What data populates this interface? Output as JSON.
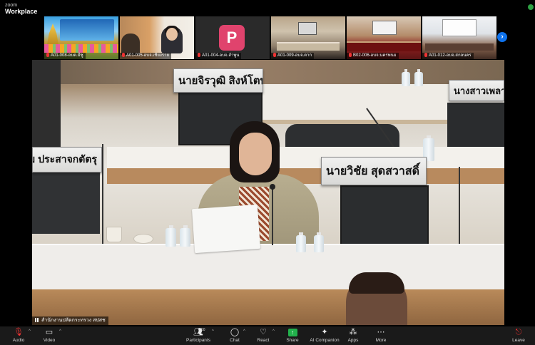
{
  "app": {
    "brand_small": "zoom",
    "brand_large": "Workplace"
  },
  "gallery_strip": {
    "tiles": [
      {
        "label": "A01-008-อบต.มีซู"
      },
      {
        "label": "A01-005-อบจ.เชียงราย"
      },
      {
        "label": "A01-004-อบจ.ลำพูน",
        "avatar_letter": "P",
        "avatar_color": "#e0436d"
      },
      {
        "label": "A01-009-อบจ.ตาก"
      },
      {
        "label": "B02-006-อบจ.นครพนม"
      },
      {
        "label": "A01-012-อบจ.สกลนคร"
      }
    ],
    "next_icon": "chevron-right-icon",
    "next_color": "#0e72ed"
  },
  "main_video": {
    "nameplates": {
      "back_left": "นายจิรวุฒิ สิงห์โตทอง",
      "back_right": "นางสาวเพลาะ",
      "mid_left": "ม ประสาจกตัตรุ",
      "mid_right": "นายวิชัย สุดสวาสดิ์"
    },
    "speaker_label": "สำนักงานปลัดกระทรวง สปสช"
  },
  "toolbar": {
    "items": [
      {
        "id": "audio",
        "label": "Audio",
        "icon": "mic-muted-icon"
      },
      {
        "id": "video",
        "label": "Video",
        "icon": "video-camera-icon"
      },
      {
        "id": "participants",
        "label": "Participants",
        "icon": "participants-icon",
        "count": "50"
      },
      {
        "id": "chat",
        "label": "Chat",
        "icon": "chat-icon"
      },
      {
        "id": "react",
        "label": "React",
        "icon": "heart-icon"
      },
      {
        "id": "share",
        "label": "Share",
        "icon": "share-screen-icon",
        "color": "#22b14c"
      },
      {
        "id": "ai_companion",
        "label": "AI Companion",
        "icon": "sparkle-icon"
      },
      {
        "id": "apps",
        "label": "Apps",
        "icon": "apps-icon"
      },
      {
        "id": "more",
        "label": "More",
        "icon": "more-icon"
      },
      {
        "id": "leave",
        "label": "Leave",
        "icon": "leave-icon",
        "color": "#e33"
      }
    ]
  }
}
